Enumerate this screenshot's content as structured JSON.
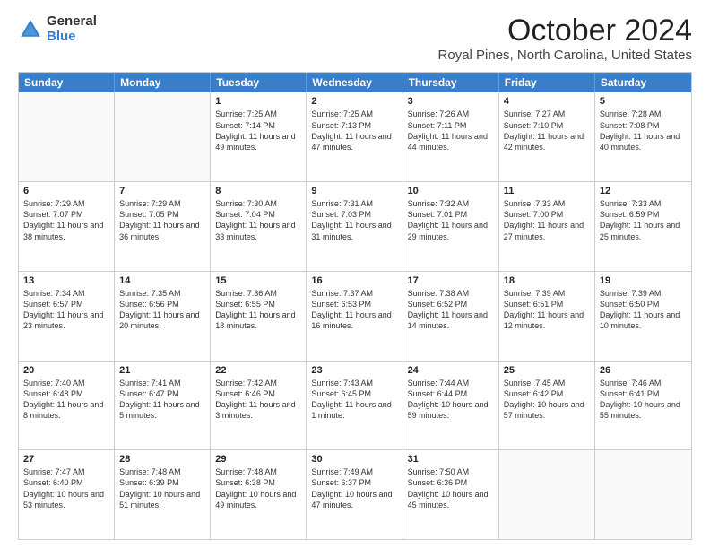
{
  "logo": {
    "general": "General",
    "blue": "Blue"
  },
  "header": {
    "month": "October 2024",
    "location": "Royal Pines, North Carolina, United States"
  },
  "weekdays": [
    "Sunday",
    "Monday",
    "Tuesday",
    "Wednesday",
    "Thursday",
    "Friday",
    "Saturday"
  ],
  "weeks": [
    [
      {
        "day": "",
        "sunrise": "",
        "sunset": "",
        "daylight": "",
        "empty": true
      },
      {
        "day": "",
        "sunrise": "",
        "sunset": "",
        "daylight": "",
        "empty": true
      },
      {
        "day": "1",
        "sunrise": "Sunrise: 7:25 AM",
        "sunset": "Sunset: 7:14 PM",
        "daylight": "Daylight: 11 hours and 49 minutes."
      },
      {
        "day": "2",
        "sunrise": "Sunrise: 7:25 AM",
        "sunset": "Sunset: 7:13 PM",
        "daylight": "Daylight: 11 hours and 47 minutes."
      },
      {
        "day": "3",
        "sunrise": "Sunrise: 7:26 AM",
        "sunset": "Sunset: 7:11 PM",
        "daylight": "Daylight: 11 hours and 44 minutes."
      },
      {
        "day": "4",
        "sunrise": "Sunrise: 7:27 AM",
        "sunset": "Sunset: 7:10 PM",
        "daylight": "Daylight: 11 hours and 42 minutes."
      },
      {
        "day": "5",
        "sunrise": "Sunrise: 7:28 AM",
        "sunset": "Sunset: 7:08 PM",
        "daylight": "Daylight: 11 hours and 40 minutes."
      }
    ],
    [
      {
        "day": "6",
        "sunrise": "Sunrise: 7:29 AM",
        "sunset": "Sunset: 7:07 PM",
        "daylight": "Daylight: 11 hours and 38 minutes."
      },
      {
        "day": "7",
        "sunrise": "Sunrise: 7:29 AM",
        "sunset": "Sunset: 7:05 PM",
        "daylight": "Daylight: 11 hours and 36 minutes."
      },
      {
        "day": "8",
        "sunrise": "Sunrise: 7:30 AM",
        "sunset": "Sunset: 7:04 PM",
        "daylight": "Daylight: 11 hours and 33 minutes."
      },
      {
        "day": "9",
        "sunrise": "Sunrise: 7:31 AM",
        "sunset": "Sunset: 7:03 PM",
        "daylight": "Daylight: 11 hours and 31 minutes."
      },
      {
        "day": "10",
        "sunrise": "Sunrise: 7:32 AM",
        "sunset": "Sunset: 7:01 PM",
        "daylight": "Daylight: 11 hours and 29 minutes."
      },
      {
        "day": "11",
        "sunrise": "Sunrise: 7:33 AM",
        "sunset": "Sunset: 7:00 PM",
        "daylight": "Daylight: 11 hours and 27 minutes."
      },
      {
        "day": "12",
        "sunrise": "Sunrise: 7:33 AM",
        "sunset": "Sunset: 6:59 PM",
        "daylight": "Daylight: 11 hours and 25 minutes."
      }
    ],
    [
      {
        "day": "13",
        "sunrise": "Sunrise: 7:34 AM",
        "sunset": "Sunset: 6:57 PM",
        "daylight": "Daylight: 11 hours and 23 minutes."
      },
      {
        "day": "14",
        "sunrise": "Sunrise: 7:35 AM",
        "sunset": "Sunset: 6:56 PM",
        "daylight": "Daylight: 11 hours and 20 minutes."
      },
      {
        "day": "15",
        "sunrise": "Sunrise: 7:36 AM",
        "sunset": "Sunset: 6:55 PM",
        "daylight": "Daylight: 11 hours and 18 minutes."
      },
      {
        "day": "16",
        "sunrise": "Sunrise: 7:37 AM",
        "sunset": "Sunset: 6:53 PM",
        "daylight": "Daylight: 11 hours and 16 minutes."
      },
      {
        "day": "17",
        "sunrise": "Sunrise: 7:38 AM",
        "sunset": "Sunset: 6:52 PM",
        "daylight": "Daylight: 11 hours and 14 minutes."
      },
      {
        "day": "18",
        "sunrise": "Sunrise: 7:39 AM",
        "sunset": "Sunset: 6:51 PM",
        "daylight": "Daylight: 11 hours and 12 minutes."
      },
      {
        "day": "19",
        "sunrise": "Sunrise: 7:39 AM",
        "sunset": "Sunset: 6:50 PM",
        "daylight": "Daylight: 11 hours and 10 minutes."
      }
    ],
    [
      {
        "day": "20",
        "sunrise": "Sunrise: 7:40 AM",
        "sunset": "Sunset: 6:48 PM",
        "daylight": "Daylight: 11 hours and 8 minutes."
      },
      {
        "day": "21",
        "sunrise": "Sunrise: 7:41 AM",
        "sunset": "Sunset: 6:47 PM",
        "daylight": "Daylight: 11 hours and 5 minutes."
      },
      {
        "day": "22",
        "sunrise": "Sunrise: 7:42 AM",
        "sunset": "Sunset: 6:46 PM",
        "daylight": "Daylight: 11 hours and 3 minutes."
      },
      {
        "day": "23",
        "sunrise": "Sunrise: 7:43 AM",
        "sunset": "Sunset: 6:45 PM",
        "daylight": "Daylight: 11 hours and 1 minute."
      },
      {
        "day": "24",
        "sunrise": "Sunrise: 7:44 AM",
        "sunset": "Sunset: 6:44 PM",
        "daylight": "Daylight: 10 hours and 59 minutes."
      },
      {
        "day": "25",
        "sunrise": "Sunrise: 7:45 AM",
        "sunset": "Sunset: 6:42 PM",
        "daylight": "Daylight: 10 hours and 57 minutes."
      },
      {
        "day": "26",
        "sunrise": "Sunrise: 7:46 AM",
        "sunset": "Sunset: 6:41 PM",
        "daylight": "Daylight: 10 hours and 55 minutes."
      }
    ],
    [
      {
        "day": "27",
        "sunrise": "Sunrise: 7:47 AM",
        "sunset": "Sunset: 6:40 PM",
        "daylight": "Daylight: 10 hours and 53 minutes."
      },
      {
        "day": "28",
        "sunrise": "Sunrise: 7:48 AM",
        "sunset": "Sunset: 6:39 PM",
        "daylight": "Daylight: 10 hours and 51 minutes."
      },
      {
        "day": "29",
        "sunrise": "Sunrise: 7:48 AM",
        "sunset": "Sunset: 6:38 PM",
        "daylight": "Daylight: 10 hours and 49 minutes."
      },
      {
        "day": "30",
        "sunrise": "Sunrise: 7:49 AM",
        "sunset": "Sunset: 6:37 PM",
        "daylight": "Daylight: 10 hours and 47 minutes."
      },
      {
        "day": "31",
        "sunrise": "Sunrise: 7:50 AM",
        "sunset": "Sunset: 6:36 PM",
        "daylight": "Daylight: 10 hours and 45 minutes."
      },
      {
        "day": "",
        "sunrise": "",
        "sunset": "",
        "daylight": "",
        "empty": true
      },
      {
        "day": "",
        "sunrise": "",
        "sunset": "",
        "daylight": "",
        "empty": true
      }
    ]
  ]
}
